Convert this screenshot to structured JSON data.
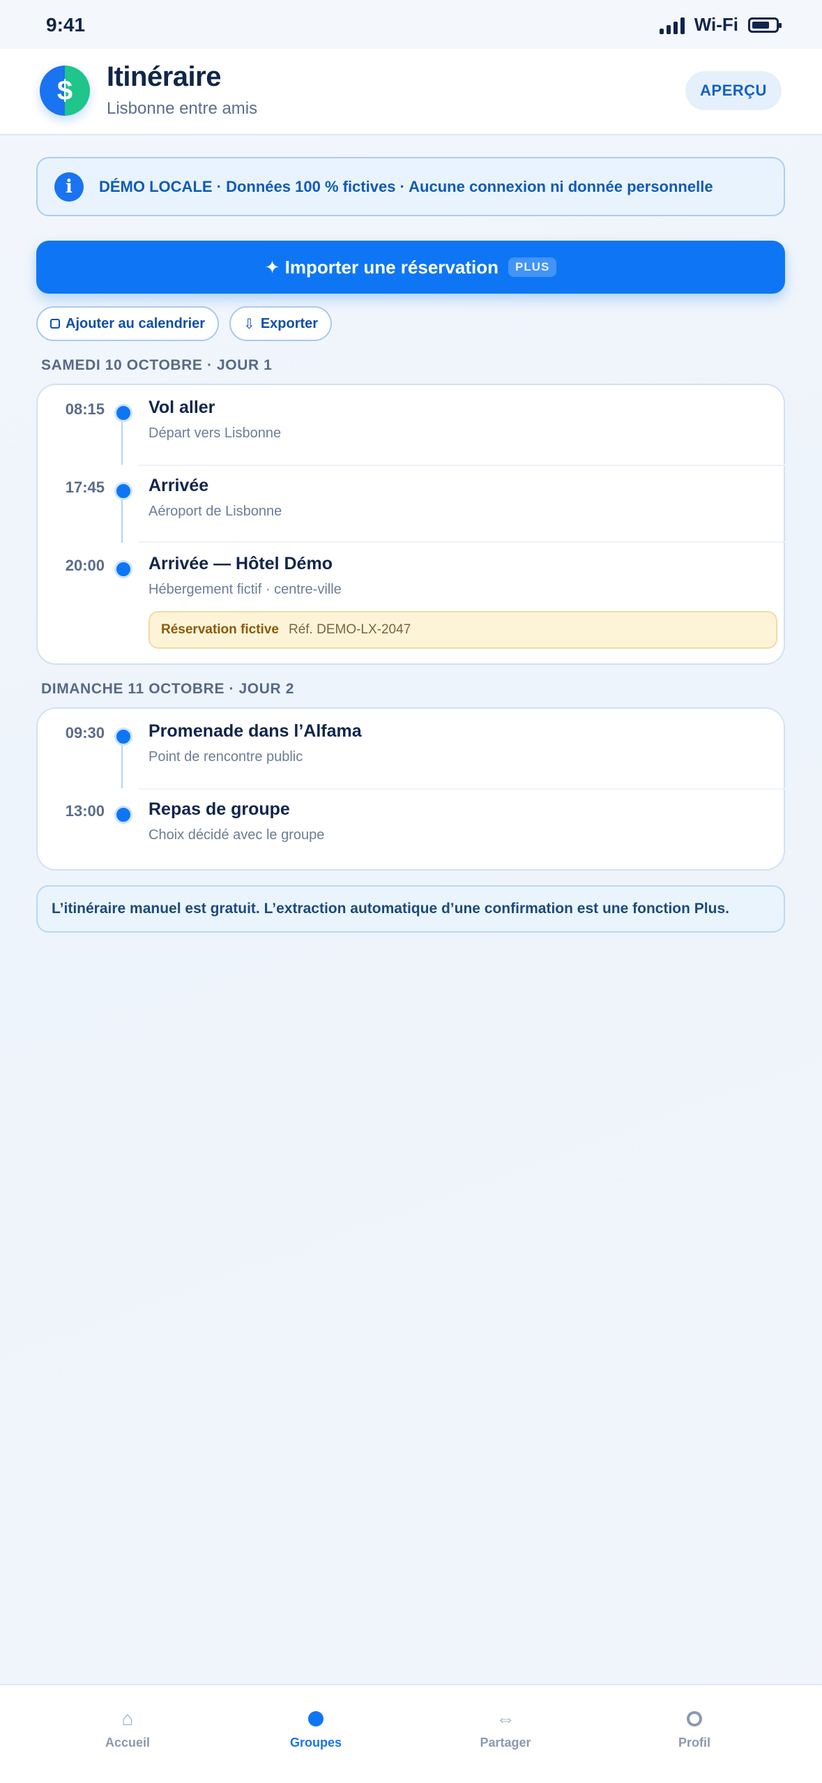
{
  "status": {
    "time": "9:41",
    "network": "Wi-Fi"
  },
  "header": {
    "logo_glyph": "$",
    "title": "Itinéraire",
    "subtitle": "Lisbonne entre amis",
    "preview_label": "APERÇU"
  },
  "demo_banner": {
    "icon": "i",
    "text": "DÉMO LOCALE · Données 100 % fictives · Aucune connexion ni donnée personnelle"
  },
  "import": {
    "label": "✦ Importer une réservation",
    "badge": "PLUS"
  },
  "actions": {
    "calendar_label": "Ajouter au calendrier",
    "export_icon": "⇩",
    "export_label": "Exporter"
  },
  "days": [
    {
      "header": "SAMEDI 10 OCTOBRE · JOUR 1",
      "events": [
        {
          "time": "08:15",
          "title": "Vol aller",
          "subtitle": "Départ vers Lisbonne"
        },
        {
          "time": "17:45",
          "title": "Arrivée",
          "subtitle": "Aéroport de Lisbonne"
        },
        {
          "time": "20:00",
          "title": "Arrivée — Hôtel Démo",
          "subtitle": "Hébergement fictif · centre-ville",
          "reservation": {
            "label": "Réservation fictive",
            "ref": "Réf. DEMO-LX-2047"
          }
        }
      ]
    },
    {
      "header": "DIMANCHE 11 OCTOBRE · JOUR 2",
      "events": [
        {
          "time": "09:30",
          "title": "Promenade dans l’Alfama",
          "subtitle": "Point de rencontre public"
        },
        {
          "time": "13:00",
          "title": "Repas de groupe",
          "subtitle": "Choix décidé avec le groupe"
        }
      ]
    }
  ],
  "note": "L’itinéraire manuel est gratuit. L’extraction automatique d’une confirmation est une fonction Plus.",
  "tabs": [
    {
      "label": "Accueil",
      "icon": "⌂",
      "active": false
    },
    {
      "label": "Groupes",
      "icon": "dot",
      "active": true
    },
    {
      "label": "Partager",
      "icon": "⇔",
      "active": false
    },
    {
      "label": "Profil",
      "icon": "ring",
      "active": false
    }
  ],
  "colors": {
    "accent": "#0e76f5",
    "brand_green": "#1fc58a",
    "text": "#10254a",
    "reservation_bg": "#fdf4d8"
  }
}
